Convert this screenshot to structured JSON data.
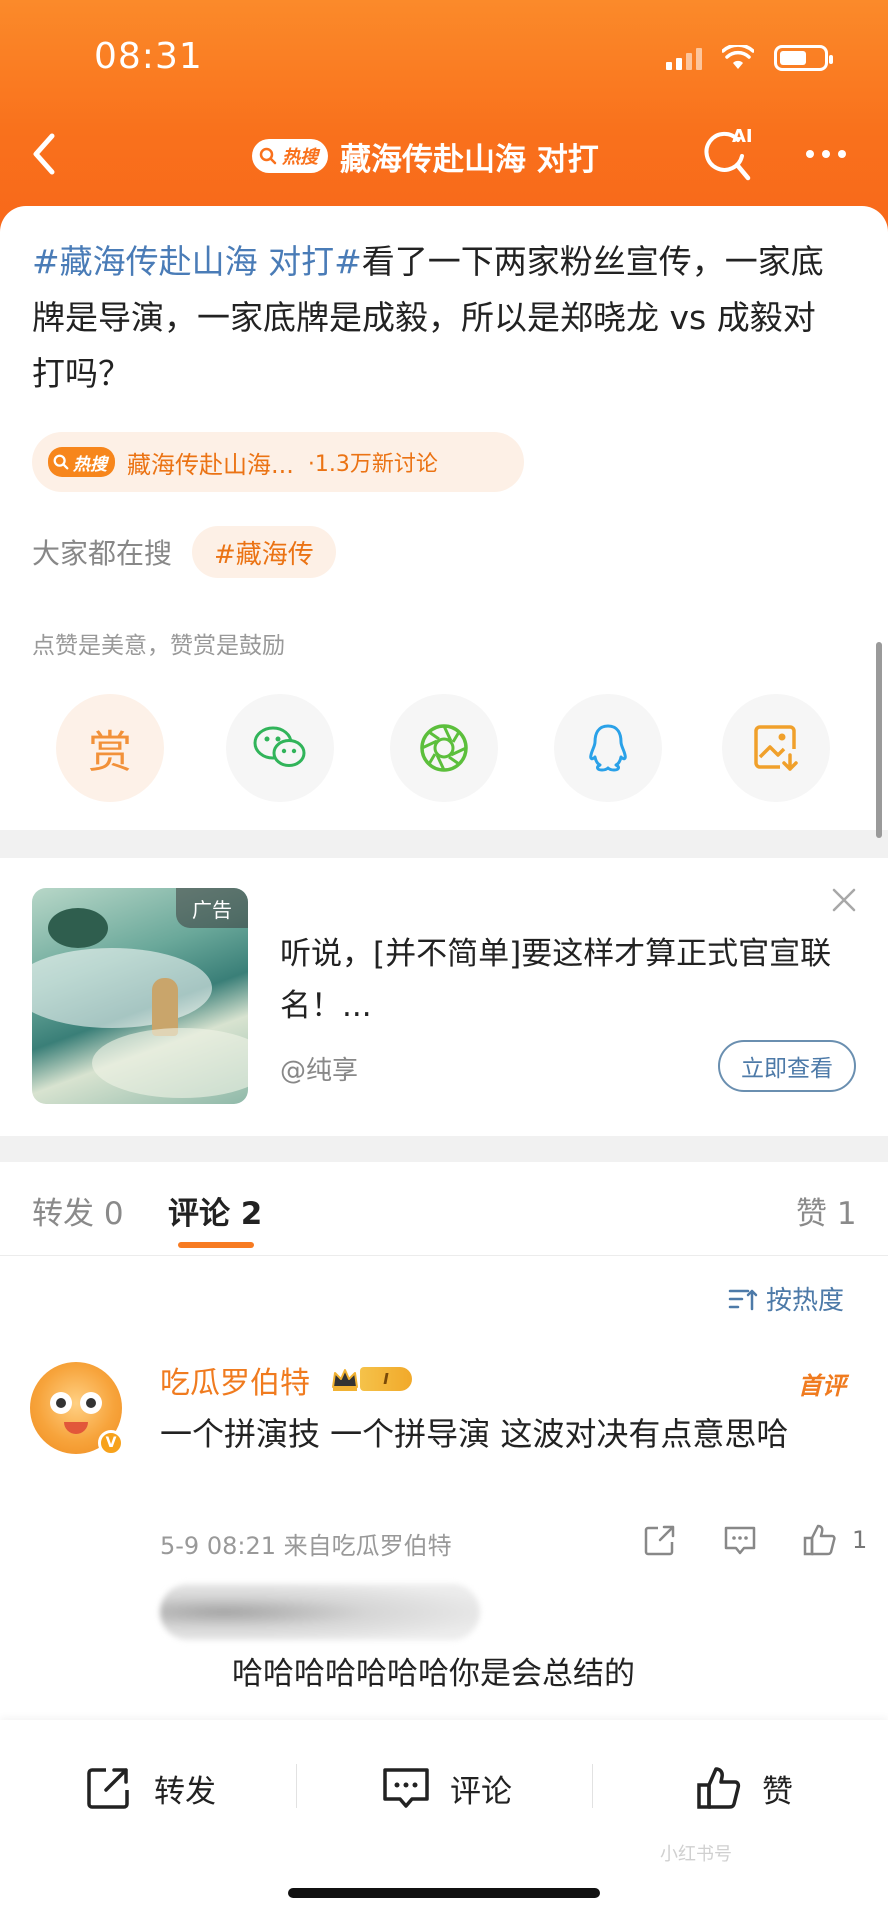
{
  "status_bar": {
    "time": "08:31"
  },
  "nav": {
    "hot_badge": "热搜",
    "title": "藏海传赴山海 对打",
    "ai_label": "AI"
  },
  "post": {
    "hashtag": "#藏海传赴山海 对打#",
    "body": "看了一下两家粉丝宣传，一家底牌是导演，一家底牌是成毅，所以是郑晓龙 vs 成毅对打吗？",
    "hot_topic": {
      "badge": "热搜",
      "name": "藏海传赴山海...",
      "count": "·1.3万新讨论"
    },
    "search": {
      "label": "大家都在搜",
      "chip": "#藏海传"
    },
    "tip": "点赞是美意，赞赏是鼓励",
    "share": {
      "reward_label": "赏",
      "buttons": [
        "reward-button",
        "wechat-share-button",
        "moments-share-button",
        "qq-share-button",
        "save-image-button"
      ]
    }
  },
  "ad": {
    "badge": "广告",
    "text": "听说，[并不简单]要这样才算正式官宣联名！...",
    "source": "@纯享",
    "button": "立即查看"
  },
  "comments": {
    "tabs": [
      {
        "label": "转发 0"
      },
      {
        "label": "评论 2"
      },
      {
        "label": "赞 1"
      }
    ],
    "sort": "按热度",
    "items": [
      {
        "name": "吃瓜罗伯特",
        "level": "I",
        "first_label": "首评",
        "text": "一个拼演技 一个拼导演 这波对决有点意思哈",
        "meta": "5-9 08:21 来自吃瓜罗伯特",
        "likes": "1",
        "reply_text": "哈哈哈哈哈哈哈你是会总结的"
      }
    ]
  },
  "bottom_bar": {
    "repost": "转发",
    "comment": "评论",
    "like": "赞",
    "watermark": "小红书号"
  },
  "colors": {
    "header_orange": "#f9711c",
    "hashtag_blue": "#4a7cb7",
    "accent_orange": "#f07b1f"
  }
}
